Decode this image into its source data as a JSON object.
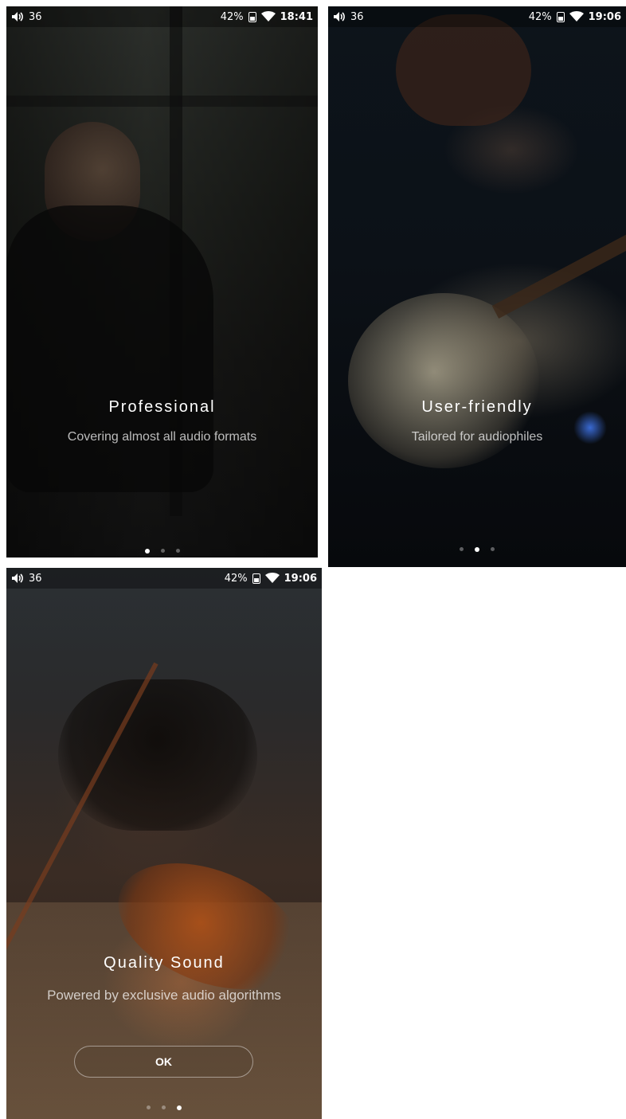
{
  "screens": [
    {
      "status": {
        "volume": "36",
        "battery": "42%",
        "time": "18:41"
      },
      "title": "Professional",
      "subtitle": "Covering almost all audio formats",
      "page_index": 1,
      "page_count": 3
    },
    {
      "status": {
        "volume": "36",
        "battery": "42%",
        "time": "19:06"
      },
      "title": "User-friendly",
      "subtitle": "Tailored for audiophiles",
      "page_index": 2,
      "page_count": 3
    },
    {
      "status": {
        "volume": "36",
        "battery": "42%",
        "time": "19:06"
      },
      "title": "Quality Sound",
      "subtitle": "Powered by exclusive audio algorithms",
      "button": "OK",
      "page_index": 3,
      "page_count": 3
    }
  ],
  "icons": {
    "volume": "volume-icon",
    "battery": "battery-icon",
    "wifi": "wifi-icon"
  },
  "colors": {
    "text": "#ffffff",
    "subtitle": "#b8b8b8",
    "dot_active": "#ffffff",
    "dot_inactive": "#7a7a7a"
  }
}
